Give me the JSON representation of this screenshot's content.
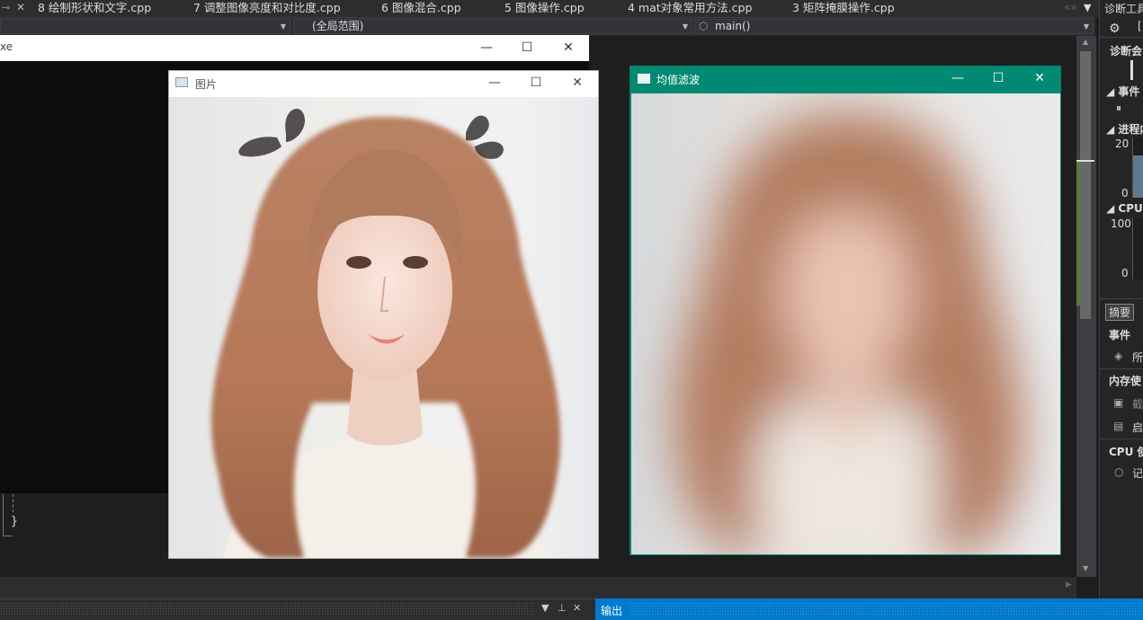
{
  "tabs": {
    "items": [
      {
        "label": "8 绘制形状和文字.cpp"
      },
      {
        "label": "7 调整图像亮度和对比度.cpp"
      },
      {
        "label": "6 图像混合.cpp"
      },
      {
        "label": "5 图像操作.cpp"
      },
      {
        "label": "4 mat对象常用方法.cpp"
      },
      {
        "label": "3 矩阵掩膜操作.cpp"
      }
    ]
  },
  "navbar": {
    "scope": "(全局范围)",
    "function": "main()"
  },
  "editor": {
    "closing_brace": "}"
  },
  "console_window": {
    "title_fragment": "xe"
  },
  "windows": {
    "picture": {
      "title": "图片"
    },
    "blur": {
      "title": "均值滤波"
    }
  },
  "window_controls": {
    "minimize": "—",
    "maximize": "☐",
    "close": "✕"
  },
  "diagnostics": {
    "header": "诊断工具",
    "session": "诊断会",
    "events_section": "事件",
    "process_memory": "进程内",
    "mem_max": "20",
    "mem_min": "0",
    "cpu_section": "CPU",
    "cpu_max": "100",
    "cpu_min": "0",
    "summary_tab": "摘要",
    "events_label": "事件",
    "events_item": "所",
    "memory_usage": "内存使",
    "snapshot_item": "截",
    "heap_item": "启",
    "cpu_usage": "CPU 使",
    "record_item": "记"
  },
  "output_panel": {
    "label": "输出"
  },
  "icons": [
    "pin-icon",
    "close-icon",
    "gear-icon",
    "window-icon",
    "minimize-icon",
    "maximize-icon",
    "dropdown-icon",
    "method-icon"
  ],
  "colors": {
    "ide_background": "#1e1e1e",
    "tab_background": "#2d2d30",
    "output_accent": "#007acc",
    "blur_window_titlebar": "#018a73"
  }
}
